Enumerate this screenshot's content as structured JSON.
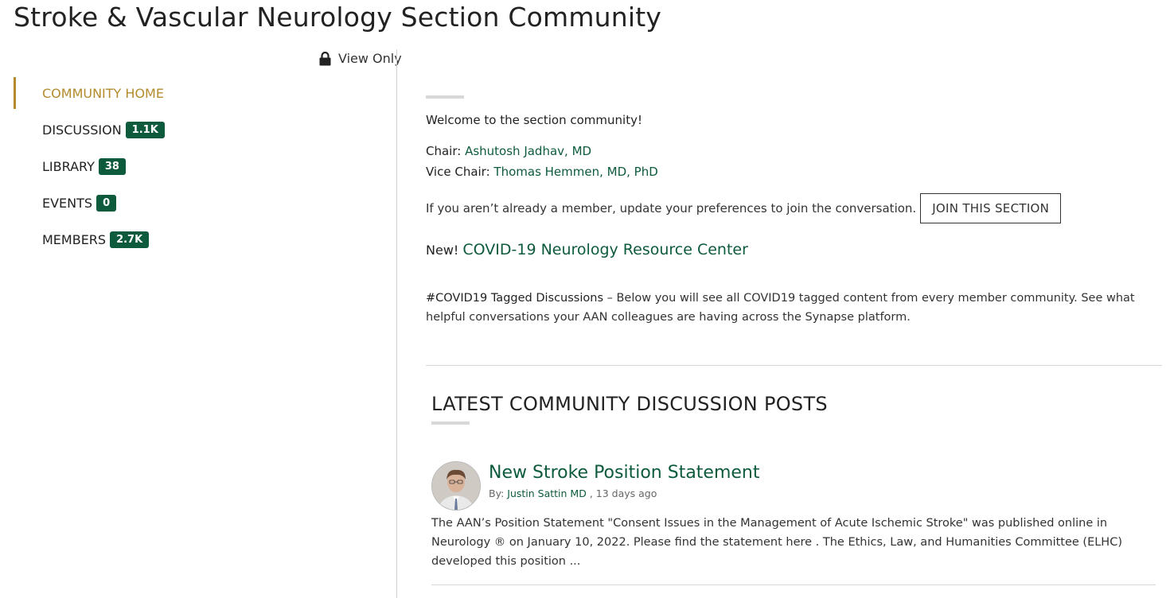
{
  "page": {
    "title": "Stroke & Vascular Neurology Section Community",
    "view_only_label": "View Only"
  },
  "nav": {
    "items": [
      {
        "label": "COMMUNITY HOME",
        "badge": null,
        "active": true
      },
      {
        "label": "DISCUSSION",
        "badge": "1.1K"
      },
      {
        "label": "LIBRARY",
        "badge": "38"
      },
      {
        "label": "EVENTS",
        "badge": "0"
      },
      {
        "label": "MEMBERS",
        "badge": "2.7K"
      }
    ]
  },
  "main": {
    "welcome": "Welcome to the section community!",
    "chair_label": "Chair:",
    "chair_name": "Ashutosh Jadhav, MD",
    "vice_chair_label": "Vice Chair:",
    "vice_chair_name": "Thomas Hemmen, MD, PhD",
    "join_text": "If you aren’t already a member, update your preferences to join the conversation.",
    "join_button": "JOIN THIS SECTION",
    "new_label": "New!",
    "covid_link": "COVID-19 Neurology Resource Center",
    "covid_tag_lead": "#COVID19 Tagged Discussions",
    "covid_tag_desc": " – Below you will see all COVID19 tagged content from every member community. See what helpful conversations your AAN colleagues are having across the Synapse platform.",
    "latest_heading": "LATEST COMMUNITY DISCUSSION POSTS"
  },
  "posts": [
    {
      "title": "New Stroke Position Statement",
      "by_label": "By:",
      "author": "Justin Sattin MD",
      "time": ", 13 days ago",
      "body": "The AAN’s Position Statement \"Consent Issues in the Management of Acute Ischemic Stroke\" was published online in Neurology ® on January 10, 2022. Please find the statement here . The Ethics, Law, and Humanities Committee (ELHC) developed this position ..."
    }
  ],
  "colors": {
    "accent_gold": "#b38b2d",
    "brand_green": "#0d5b3c",
    "divider": "#d8d8d8"
  },
  "icons": {
    "lock": "lock-icon",
    "avatar": "avatar"
  }
}
